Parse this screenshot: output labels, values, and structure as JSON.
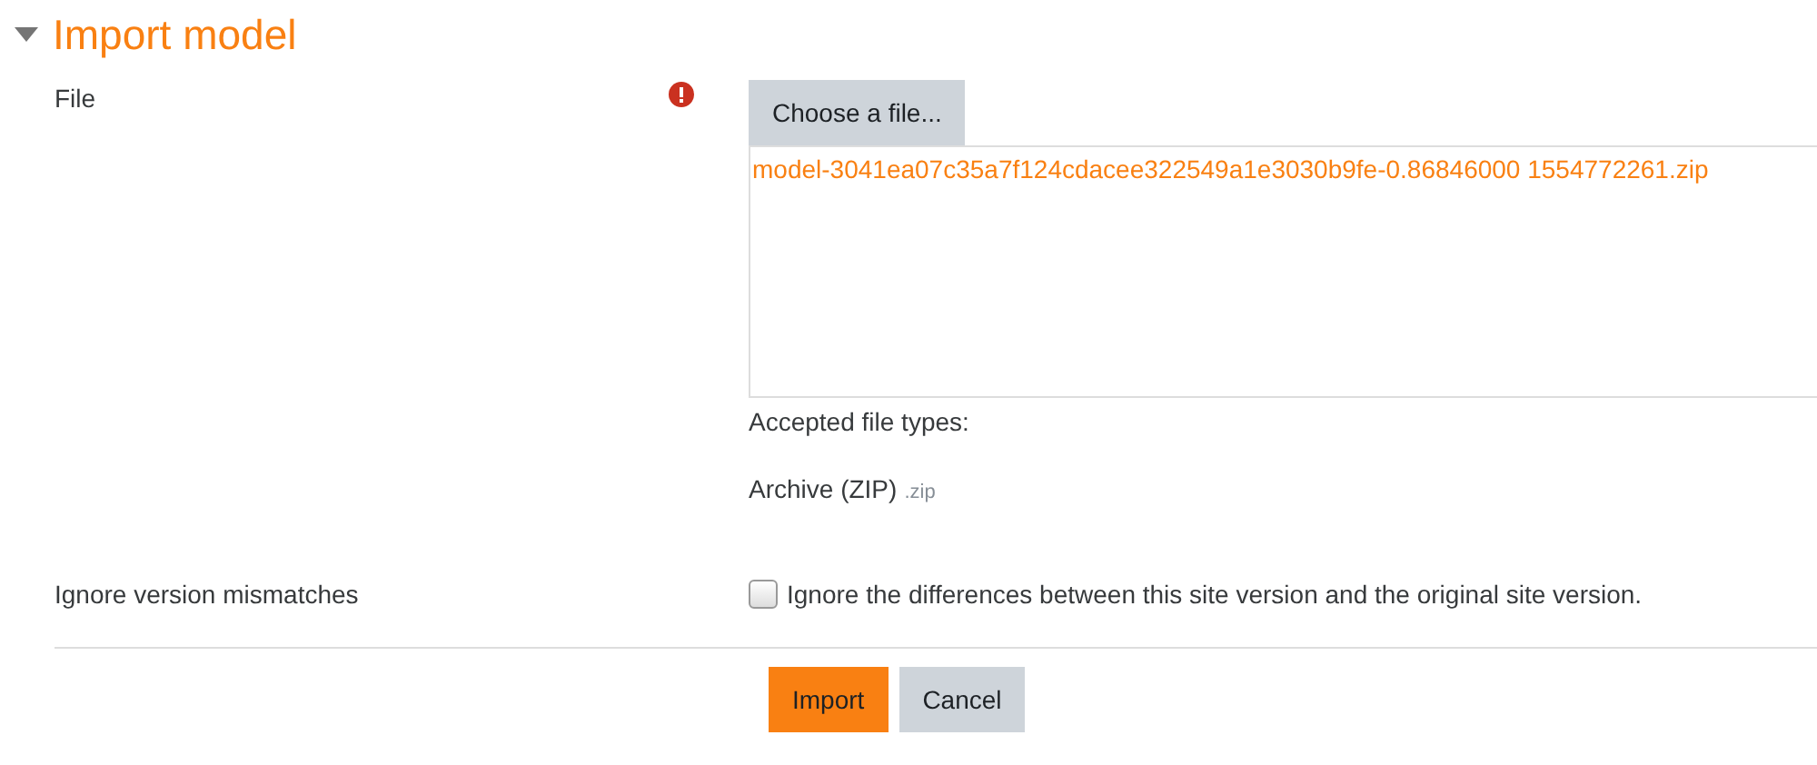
{
  "section": {
    "title": "Import model",
    "expanded": true
  },
  "file_field": {
    "label": "File",
    "required": true,
    "button": "Choose a file...",
    "files": [
      "model-3041ea07c35a7f124cdacee322549a1e3030b9fe-0.86846000 1554772261.zip"
    ],
    "accepted_heading": "Accepted file types:",
    "accepted_types": [
      {
        "name": "Archive (ZIP)",
        "extension": ".zip"
      }
    ]
  },
  "ignore_field": {
    "label": "Ignore version mismatches",
    "checkbox_label": "Ignore the differences between this site version and the original site version.",
    "checked": false
  },
  "buttons": [
    {
      "label": "Import",
      "kind": "primary"
    },
    {
      "label": "Cancel",
      "kind": "secondary"
    }
  ]
}
